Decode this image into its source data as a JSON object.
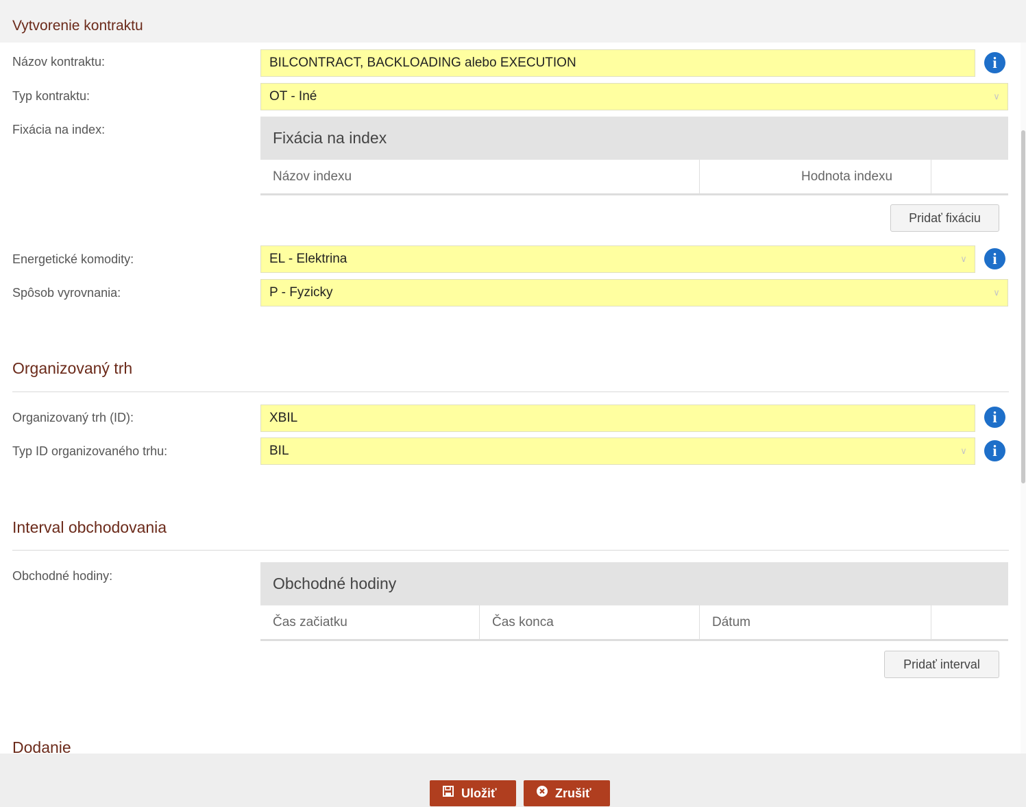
{
  "modal": {
    "title": "Vytvorenie kontraktu"
  },
  "contract": {
    "name_label": "Názov kontraktu:",
    "name_value": "BILCONTRACT, BACKLOADING alebo EXECUTION",
    "type_label": "Typ kontraktu:",
    "type_value": "OT - Iné",
    "fixation_label": "Fixácia na index:",
    "fixation_panel": {
      "title": "Fixácia na index",
      "columns": [
        "Názov indexu",
        "Hodnota indexu"
      ],
      "add_button": "Pridať fixáciu"
    },
    "commodity_label": "Energetické komodity:",
    "commodity_value": "EL - Elektrina",
    "settlement_label": "Spôsob vyrovnania:",
    "settlement_value": "P - Fyzicky"
  },
  "organized_market": {
    "section_title": "Organizovaný trh",
    "id_label": "Organizovaný trh (ID):",
    "id_value": "XBIL",
    "id_type_label": "Typ ID organizovaného trhu:",
    "id_type_value": "BIL"
  },
  "trading_interval": {
    "section_title": "Interval obchodovania",
    "hours_label": "Obchodné hodiny:",
    "hours_panel": {
      "title": "Obchodné hodiny",
      "columns": [
        "Čas začiatku",
        "Čas konca",
        "Dátum"
      ],
      "add_button": "Pridať interval"
    }
  },
  "delivery": {
    "section_title": "Dodanie"
  },
  "footer": {
    "save_label": "Uložiť",
    "cancel_label": "Zrušiť"
  },
  "icons": {
    "info": "info-icon",
    "save": "floppy-disk-icon",
    "cancel": "close-circle-icon",
    "dropdown": "chevron-down-icon"
  },
  "colors": {
    "accent": "#6b2a1a",
    "button": "#b03e1f",
    "field_bg": "#ffffa0",
    "info": "#1e6fc9"
  }
}
